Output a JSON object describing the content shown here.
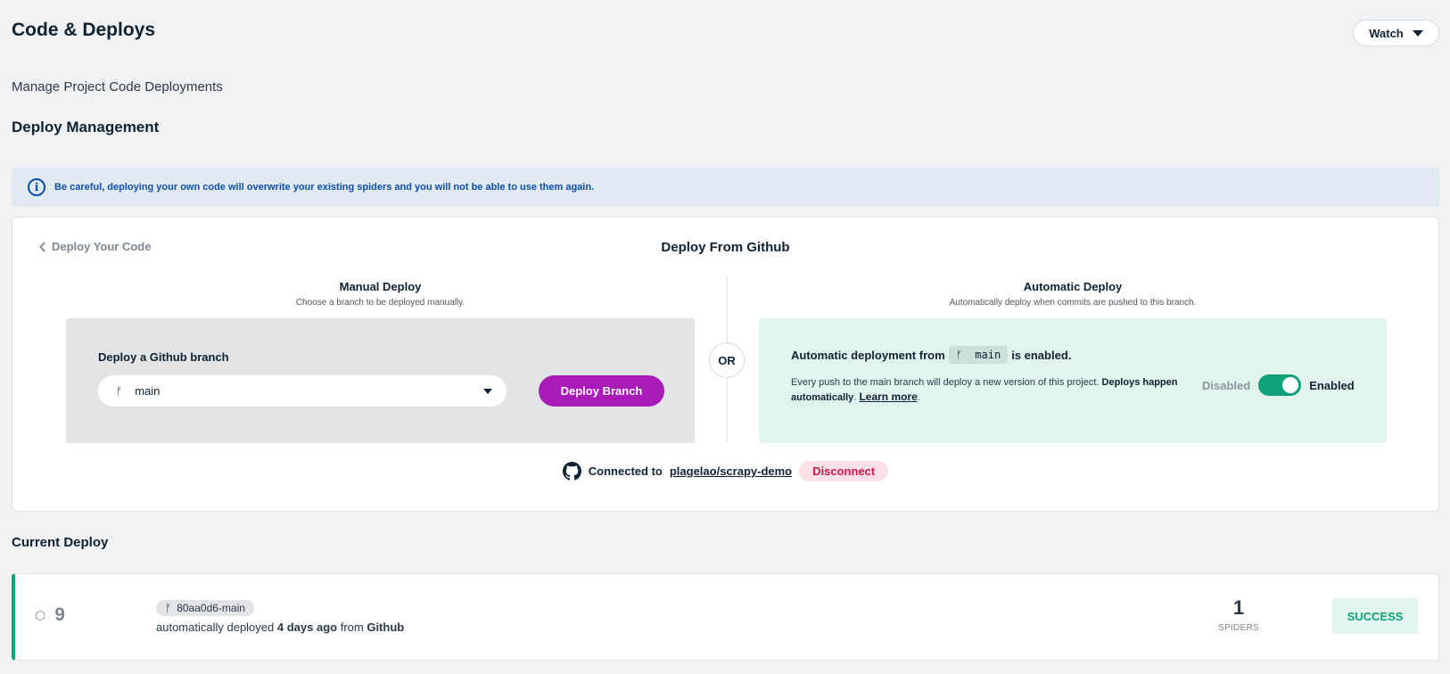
{
  "header": {
    "title": "Code & Deploys",
    "watch_label": "Watch"
  },
  "subtitle": "Manage Project Code Deployments",
  "deploy_management": {
    "title": "Deploy Management",
    "alert": "Be careful, deploying your own code will overwrite your existing spiders and you will not be able to use them again."
  },
  "card": {
    "back_label": "Deploy Your Code",
    "title": "Deploy From Github",
    "manual": {
      "title": "Manual Deploy",
      "subtitle": "Choose a branch to be deployed manually.",
      "label": "Deploy a Github branch",
      "branch_value": "main",
      "button": "Deploy Branch"
    },
    "or_label": "OR",
    "automatic": {
      "title": "Automatic Deploy",
      "subtitle": "Automatically deploy when commits are pushed to this branch.",
      "head_prefix": "Automatic deployment from",
      "branch": "main",
      "head_suffix": "is enabled.",
      "body_text": "Every push to the main branch will deploy a new version of this project.",
      "body_bold": "Deploys happen automatically",
      "learn_more": "Learn more",
      "toggle_off_label": "Disabled",
      "toggle_on_label": "Enabled",
      "toggle_state": true
    },
    "connection": {
      "prefix": "Connected to",
      "repo": "plagelao/scrapy-demo",
      "disconnect": "Disconnect"
    }
  },
  "current_deploy": {
    "title": "Current Deploy",
    "number": "9",
    "commit": "80aa0d6-main",
    "meta_prefix": "automatically deployed",
    "meta_time": "4 days ago",
    "meta_from": "from",
    "meta_source": "Github",
    "spiders_count": "1",
    "spiders_label": "SPIDERS",
    "status": "SUCCESS"
  },
  "colors": {
    "accent_purple": "#a81bb8",
    "success_green": "#10a07a",
    "info_blue": "#0b4fa8",
    "danger_red": "#d11648"
  }
}
